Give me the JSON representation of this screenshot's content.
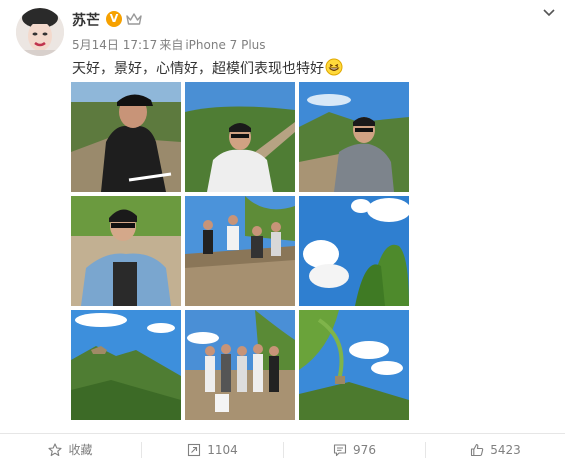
{
  "post": {
    "author": "苏芒",
    "verified_badge": "V",
    "date": "5月14日 17:17",
    "source_prefix": "来自",
    "source": "iPhone 7 Plus",
    "caption": "天好，景好，心情好，超模们表现也特好",
    "emoji": "grinning-emoji",
    "photos": [
      {
        "name": "photo-woman-cap-great-wall"
      },
      {
        "name": "photo-man-white-hoodie"
      },
      {
        "name": "photo-man-grey-sweater"
      },
      {
        "name": "photo-man-denim-jacket"
      },
      {
        "name": "photo-group-jumping"
      },
      {
        "name": "photo-sky-clouds"
      },
      {
        "name": "photo-mountains-blue-sky"
      },
      {
        "name": "photo-group-posing"
      },
      {
        "name": "photo-leaves-watchtower"
      }
    ]
  },
  "footer": {
    "favorite_label": "收藏",
    "repost_count": "1104",
    "comment_count": "976",
    "like_count": "5423"
  },
  "colors": {
    "badge": "#f6a100",
    "muted_text": "#808080",
    "text": "#333333",
    "sky": "#3a8fd8",
    "grass": "#5a8a3a"
  }
}
